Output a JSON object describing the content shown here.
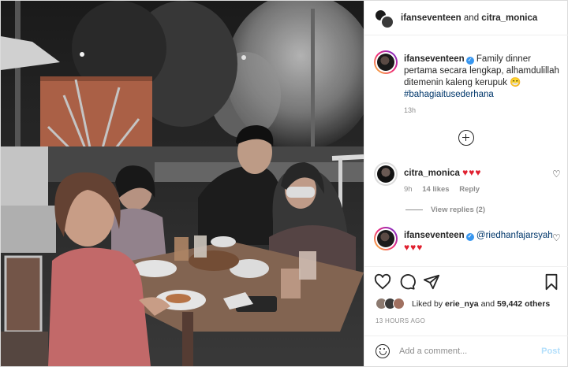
{
  "header": {
    "user1": "ifanseventeen",
    "and": "and",
    "user2": "citra_monica"
  },
  "caption": {
    "username": "ifanseventeen",
    "text": "Family dinner pertama secara lengkap, alhamdulillah ditemenin kaleng kerupuk 😁",
    "hashtag": "#bahagiaitusederhana",
    "time": "13h"
  },
  "comments": [
    {
      "username": "citra_monica",
      "text": "♥♥♥",
      "time": "9h",
      "likes": "14 likes",
      "reply": "Reply",
      "view_replies": "View replies (2)"
    },
    {
      "username": "ifanseventeen",
      "mention": "@riedhanfajarsyah",
      "text": "♥♥♥"
    }
  ],
  "likes": {
    "prefix": "Liked by",
    "user": "erie_nya",
    "and": "and",
    "count": "59,442 others"
  },
  "post_time": "13 HOURS AGO",
  "add_comment": {
    "placeholder": "Add a comment...",
    "post_label": "Post"
  },
  "colors": {
    "verified": "#3897f0",
    "heart": "#e0202f",
    "link": "#00376b",
    "post_button_disabled": "#b2dffc"
  },
  "icons": [
    "heart-icon",
    "comment-icon",
    "share-icon",
    "bookmark-icon",
    "plus-circle-icon",
    "emoji-icon",
    "verified-icon"
  ]
}
